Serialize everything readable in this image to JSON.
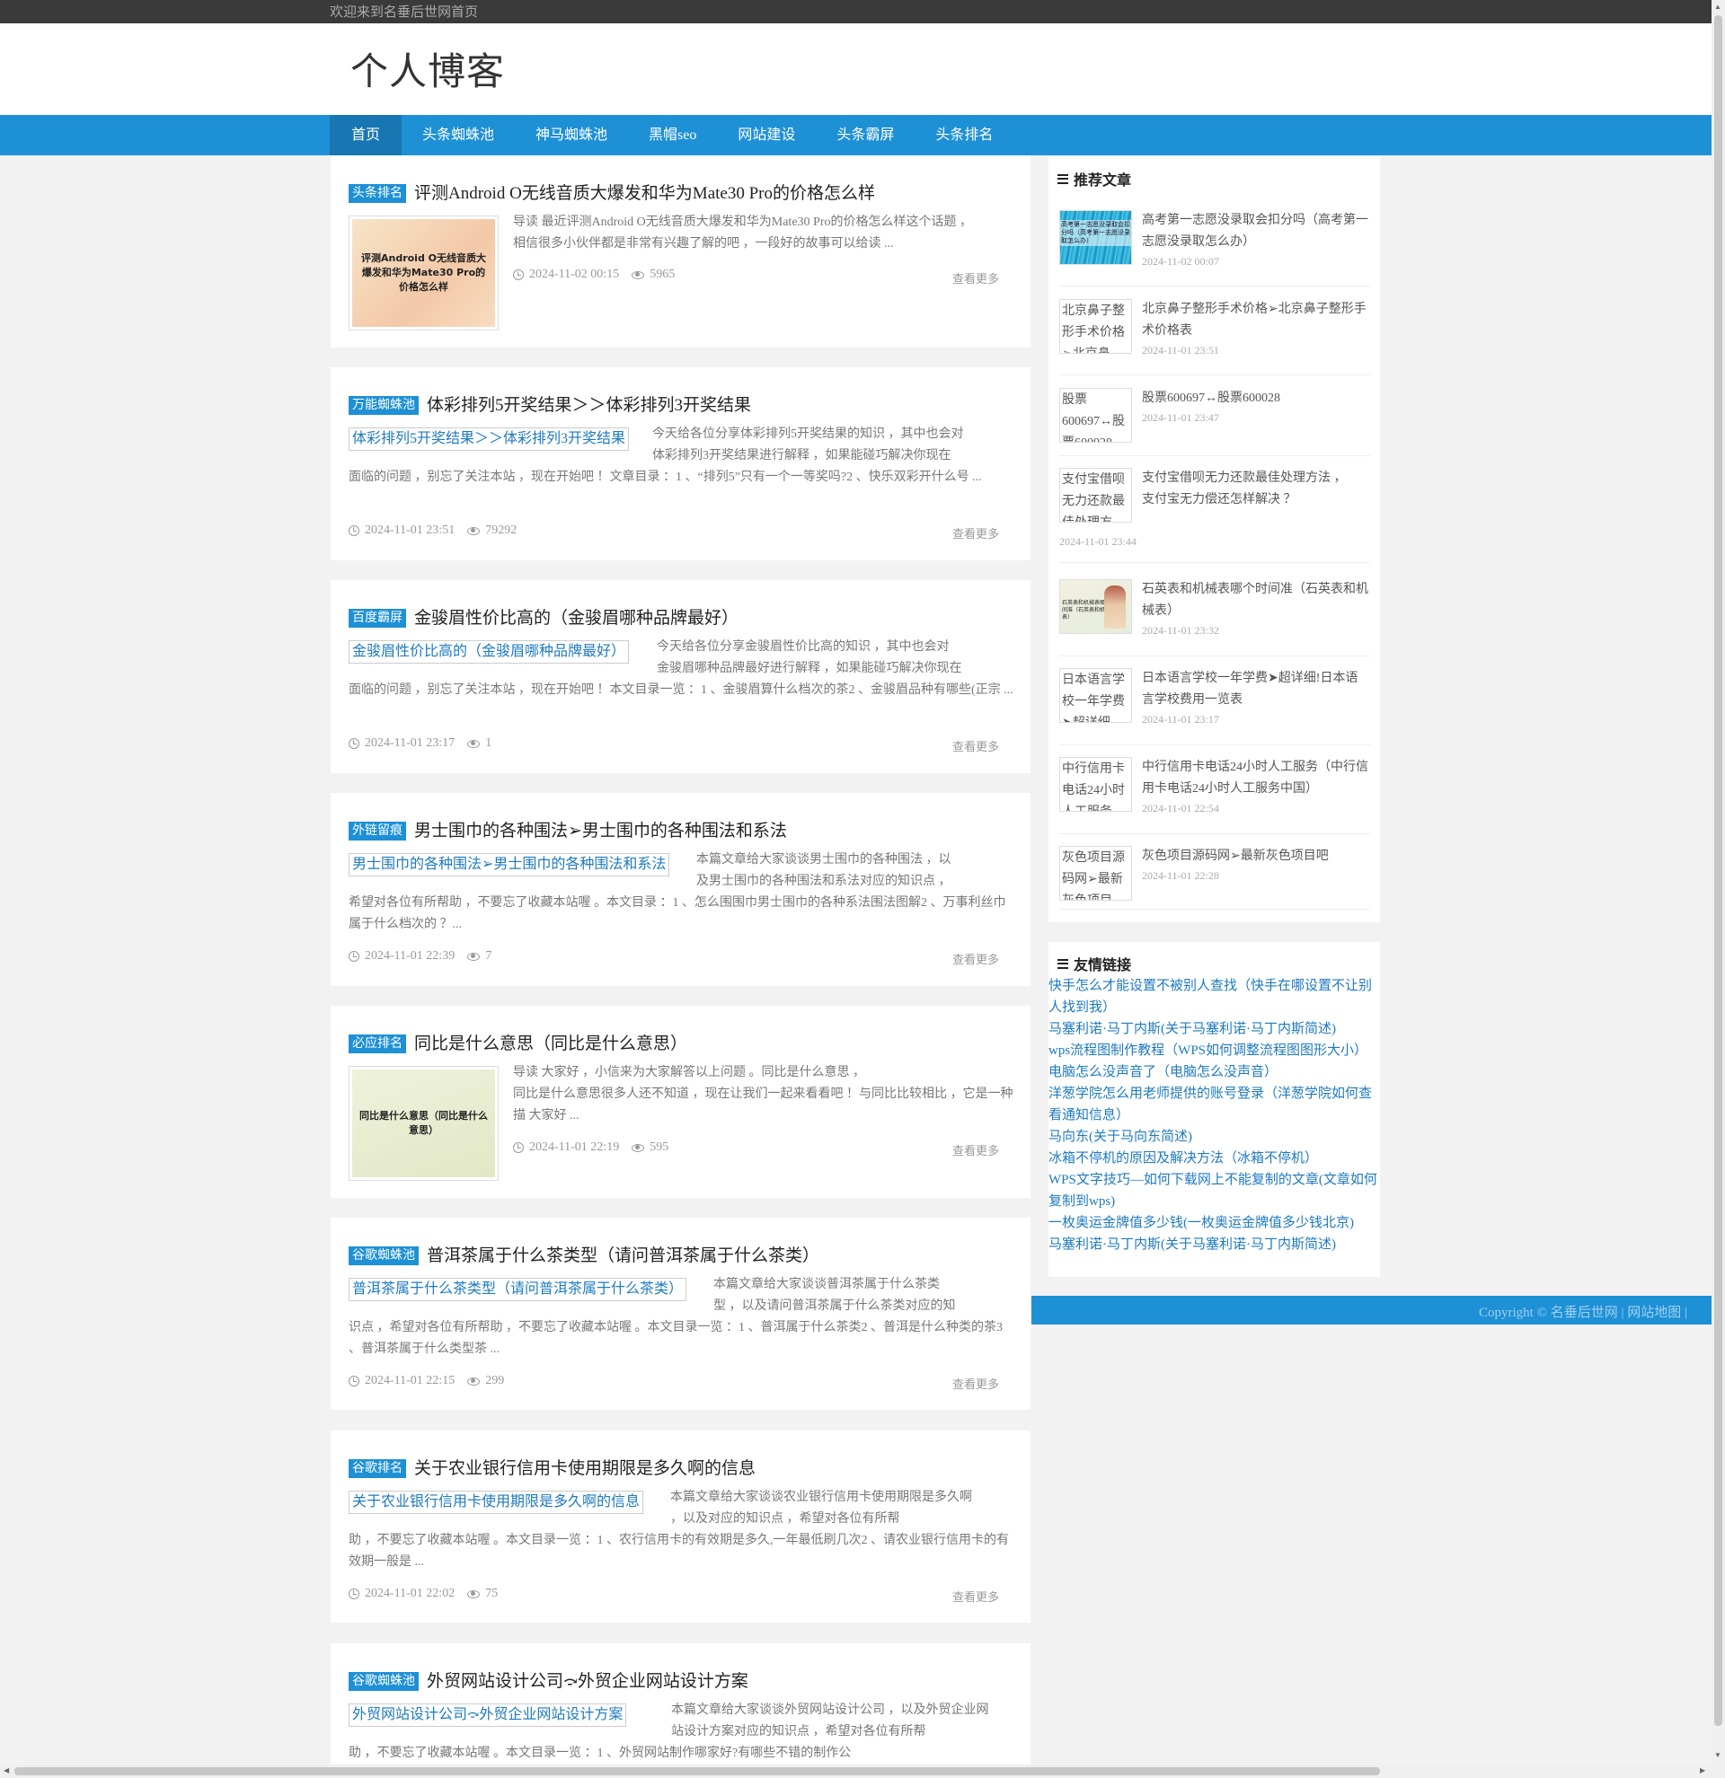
{
  "topbar": {
    "welcome": "欢迎来到名垂后世网首页"
  },
  "header": {
    "site_title": "个人博客"
  },
  "nav": {
    "items": [
      "首页",
      "头条蜘蛛池",
      "神马蜘蛛池",
      "黑帽seo",
      "网站建设",
      "头条霸屏",
      "头条排名"
    ]
  },
  "posts": [
    {
      "tag": "头条排名",
      "title": "评测Android O无线音质大爆发和华为Mate30 Pro的价格怎么样",
      "thumb_text": "评测Android O无线音质大爆发和华为Mate30 Pro的价格怎么样",
      "excerpt_first": "导读 最近评测Android O无线音质大爆发和华为Mate30 Pro的价格怎么样这个话题        ，",
      "excerpt_rest": "相信很多小伙伴都是非常有兴趣了解的吧        ，一段好的故事可以给读 ...",
      "date": "2024-11-02 00:15",
      "views": "5965",
      "more": "查看更多"
    },
    {
      "tag": "万能蜘蛛池",
      "title": "体彩排列5开奖结果＞＞体彩排列3开奖结果",
      "alt": "体彩排列5开奖结果＞＞体彩排列3开奖结果",
      "excerpt_first": "今天给各位分享体彩排列5开奖结果的知识        ，其中也会对",
      "excerpt_second": "体彩排列3开奖结果进行解释          ，如果能碰巧解决你现在",
      "excerpt_rest": "面临的问题          ，别忘了关注本站        ，现在开始吧        ！文章目录        ：1          、“排列5”只有一个一等奖吗?2        、快乐双彩开什么号 ...",
      "date": "2024-11-01 23:51",
      "views": "79292",
      "more": "查看更多"
    },
    {
      "tag": "百度霸屏",
      "title": "金骏眉性价比高的（金骏眉哪种品牌最好）",
      "alt": "金骏眉性价比高的（金骏眉哪种品牌最好）",
      "excerpt_first": "今天给各位分享金骏眉性价比高的知识        ，其中也会对",
      "excerpt_second": "金骏眉哪种品牌最好进行解释          ，如果能碰巧解决你现在",
      "excerpt_rest": "面临的问题        ，别忘了关注本站            ，现在开始吧      ！本文目录一览          ：1      、金骏眉算什么档次的茶2      、金骏眉品种有哪些(正宗 ...",
      "date": "2024-11-01 23:17",
      "views": "1",
      "more": "查看更多"
    },
    {
      "tag": "外链留痕",
      "title": "男士围巾的各种围法➢男士围巾的各种围法和系法",
      "alt": "男士围巾的各种围法➢男士围巾的各种围法和系法",
      "excerpt_first": "本篇文章给大家谈谈男士围巾的各种围法            ，以",
      "excerpt_second": "及男士围巾的各种围法和系法对应的知识点            ，",
      "excerpt_rest": "希望对各位有所帮助          ，不要忘了收藏本站喔        。本文目录      ：1        、怎么围围巾男士围巾的各种系法围法图解2        、万事利丝巾属于什么档次的            ？...",
      "date": "2024-11-01 22:39",
      "views": "7",
      "more": "查看更多"
    },
    {
      "tag": "必应排名",
      "title": "同比是什么意思（同比是什么意思）",
      "thumb_text": "同比是什么意思（同比是什么意思）",
      "excerpt_first": "导读 大家好            ，小信来为大家解答以上问题          。同比是什么意思            ，",
      "excerpt_rest": "同比是什么意思很多人还不知道        ，现在让我们一起来看看吧          ！与同比比较相比            ，它是一种描 大家好 ...",
      "date": "2024-11-01 22:19",
      "views": "595",
      "more": "查看更多"
    },
    {
      "tag": "谷歌蜘蛛池",
      "title": "普洱茶属于什么茶类型（请问普洱茶属于什么茶类）",
      "alt": "普洱茶属于什么茶类型（请问普洱茶属于什么茶类）",
      "excerpt_first": "本篇文章给大家谈谈普洱茶属于什么茶类",
      "excerpt_second": "型          ，以及请问普洱茶属于什么茶类对应的知",
      "excerpt_rest": "识点        ，希望对各位有所帮助          ，不要忘了收藏本站喔        。本文目录一览        ：1        、普洱属于什么茶类2        、普洱是什么种类的茶3            、普洱茶属于什么类型茶 ...",
      "date": "2024-11-01 22:15",
      "views": "299",
      "more": "查看更多"
    },
    {
      "tag": "谷歌排名",
      "title": "关于农业银行信用卡使用期限是多久啊的信息",
      "alt": "关于农业银行信用卡使用期限是多久啊的信息",
      "excerpt_first": "本篇文章给大家谈谈农业银行信用卡使用期限是多久啊",
      "excerpt_second": "        ，以及对应的知识点          ，希望对各位有所帮",
      "excerpt_rest": "助        ，不要忘了收藏本站喔        。本文目录一览            ：1        、农行信用卡的有效期是多久,一年最低刷几次2        、请农业银行信用卡的有效期一般是 ...",
      "date": "2024-11-01 22:02",
      "views": "75",
      "more": "查看更多"
    },
    {
      "tag": "谷歌蜘蛛池",
      "title": "外贸网站设计公司⤼外贸企业网站设计方案",
      "alt": "外贸网站设计公司⤼外贸企业网站设计方案",
      "excerpt_first": "本篇文章给大家谈谈外贸网站设计公司        ，以及外贸企业网",
      "excerpt_second": "站设计方案对应的知识点        ，希望对各位有所帮",
      "excerpt_rest": "助            ，不要忘了收藏本站喔        。本文目录一览      ：1          、外贸网站制作哪家好?有哪些不错的制作公"
    }
  ],
  "recommend": {
    "title": "推荐文章",
    "items": [
      {
        "thumb": "高考第一志愿没录取会扣分吗（高考第一志愿没录取怎么办）",
        "title": "高考第一志愿没录取会扣分吗（高考第一志愿没录取怎么办）",
        "date": "2024-11-02 00:07"
      },
      {
        "thumb": "北京鼻子整形手术价格➢北京鼻",
        "title": "北京鼻子整形手术价格➢北京鼻子整形手术价格表",
        "date": "2024-11-01 23:51"
      },
      {
        "thumb": "股票600697↔股票600028",
        "title": "股票600697↔股票600028",
        "date": "2024-11-01 23:47"
      },
      {
        "thumb": "支付宝借呗无力还款最佳处理方",
        "title": "支付宝借呗无力还款最佳处理方法        ，支付宝无力偿还怎样解决        ？",
        "date": "2024-11-01 23:44"
      },
      {
        "thumb": "石英表和机械表哪个时间准（石英表和机械表）",
        "title": "石英表和机械表哪个时间准（石英表和机械表）",
        "date": "2024-11-01 23:32"
      },
      {
        "thumb": "日本语言学校一年学费➤超详细",
        "title": "日本语言学校一年学费➤超详细!日本语言学校费用一览表",
        "date": "2024-11-01 23:17"
      },
      {
        "thumb": "中行信用卡电话24小时人工服务",
        "title": "中行信用卡电话24小时人工服务（中行信用卡电话24小时人工服务中国）",
        "date": "2024-11-01 22:54"
      },
      {
        "thumb": "灰色项目源码网➢最新灰色项目",
        "title": "灰色项目源码网➢最新灰色项目吧",
        "date": "2024-11-01 22:28"
      }
    ]
  },
  "links": {
    "title": "友情链接",
    "items": [
      "快手怎么才能设置不被别人查找（快手在哪设置不让别人找到我）",
      "马塞利诺·马丁内斯(关于马塞利诺·马丁内斯简述)",
      "wps流程图制作教程（WPS如何调整流程图图形大小）",
      "电脑怎么没声音了（电脑怎么没声音）",
      "洋葱学院怎么用老师提供的账号登录（洋葱学院如何查看通知信息）",
      "马向东(关于马向东简述)",
      "冰箱不停机的原因及解决方法（冰箱不停机）",
      "WPS文字技巧—如何下载网上不能复制的文章(文章如何复制到wps)",
      "一枚奥运金牌值多少钱(一枚奥运金牌值多少钱北京)",
      "马塞利诺·马丁内斯(关于马塞利诺·马丁内斯简述)"
    ]
  },
  "footer": {
    "copyright": "Copyright © 名垂后世网 | 网站地图 |"
  },
  "colors": {
    "accent": "#1e90d6",
    "topbar": "#3a3a3a",
    "link": "#1e7ac0"
  }
}
